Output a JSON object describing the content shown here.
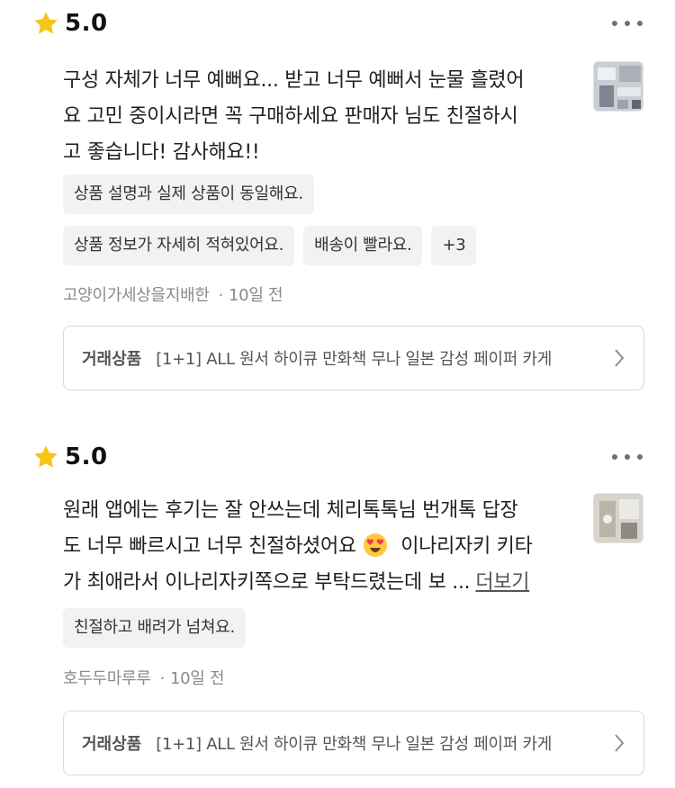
{
  "colors": {
    "star": "#F5C518",
    "tag_bg": "#F2F2F2",
    "meta_text": "#8A8A8A",
    "card_border": "#D9D9D9"
  },
  "reviews": [
    {
      "rating": "5.0",
      "body_lines": [
        "구성 자체가 너무 예뻐요... 받고 너무 예뻐서 눈물 흘렸어",
        "요 고민 중이시라면 꼭 구매하세요 판매자 님도 친절하시",
        "고 좋습니다! 감사해요!!"
      ],
      "more_label": "",
      "tags": [
        "상품 설명과 실제 상품이 동일해요.",
        "상품 정보가 자세히 적혀있어요.",
        "배송이 빨라요.",
        "+3"
      ],
      "author": "고양이가세상을지배한",
      "time": "10일 전",
      "product_label": "거래상품",
      "product_name": "[1+1] ALL 원서 하이큐 만화책 무나 일본 감성 페이퍼 카게"
    },
    {
      "rating": "5.0",
      "body_lines": [
        "원래 앱에는 후기는 잘 안쓰는데 체리톡톡님 번개톡 답장",
        "도 너무 빠르시고 너무 친절하셨어요",
        "가 최애라서 이나리자키쪽으로 부탁드렸는데 보 ..."
      ],
      "emoji_line_suffix": "이나리자키 키타",
      "more_label": "더보기",
      "tags": [
        "친절하고 배려가 넘쳐요."
      ],
      "author": "호두두마루루",
      "time": "10일 전",
      "product_label": "거래상품",
      "product_name": "[1+1] ALL 원서 하이큐 만화책 무나 일본 감성 페이퍼 카게"
    }
  ]
}
